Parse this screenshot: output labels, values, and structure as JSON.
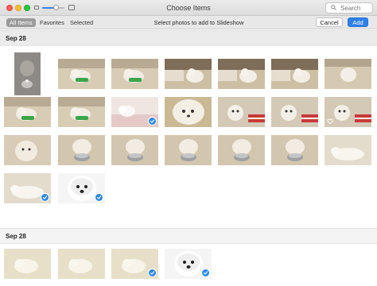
{
  "window": {
    "title": "Choose Items",
    "search_placeholder": "Search",
    "icons": [
      "close-button",
      "minimize-button",
      "zoom-button",
      "zoom-small-icon",
      "zoom-large-icon",
      "search-icon"
    ],
    "zoom_slider_fraction": 0.6
  },
  "toolbar": {
    "tabs": [
      {
        "label": "All Items",
        "active": true
      },
      {
        "label": "Favorites",
        "active": false
      },
      {
        "label": "Selected",
        "active": false
      }
    ],
    "instruction": "Select photos to add to Slideshow",
    "cancel_label": "Cancel",
    "add_label": "Add",
    "accent": "#2f80ed"
  },
  "sections": [
    {
      "date": "Sep 28",
      "photos": [
        {
          "scene": "portrait-dark",
          "selected": false,
          "favorite": false
        },
        {
          "scene": "floor-toy",
          "selected": false,
          "favorite": false
        },
        {
          "scene": "floor-toy",
          "selected": false,
          "favorite": false
        },
        {
          "scene": "crate-dog",
          "selected": false,
          "favorite": false
        },
        {
          "scene": "crate-dog",
          "selected": false,
          "favorite": false
        },
        {
          "scene": "crate-dog",
          "selected": false,
          "favorite": false
        },
        {
          "scene": "floor-dog",
          "selected": false,
          "favorite": false
        },
        {
          "scene": "floor-toy",
          "selected": false,
          "favorite": false
        },
        {
          "scene": "floor-toy",
          "selected": false,
          "favorite": false
        },
        {
          "scene": "bed-dog",
          "selected": true,
          "favorite": false
        },
        {
          "scene": "closeup",
          "selected": false,
          "favorite": false
        },
        {
          "scene": "dog-stripe",
          "selected": false,
          "favorite": false
        },
        {
          "scene": "dog-stripe",
          "selected": false,
          "favorite": false
        },
        {
          "scene": "dog-stripe",
          "selected": false,
          "favorite": true
        },
        {
          "scene": "fluffy",
          "selected": false,
          "favorite": false
        },
        {
          "scene": "bowl-dog",
          "selected": false,
          "favorite": false
        },
        {
          "scene": "bowl-dog",
          "selected": false,
          "favorite": false
        },
        {
          "scene": "bowl-dog",
          "selected": false,
          "favorite": false
        },
        {
          "scene": "bowl-dog",
          "selected": false,
          "favorite": false
        },
        {
          "scene": "bowl-dog",
          "selected": false,
          "favorite": false
        },
        {
          "scene": "lying-dog",
          "selected": false,
          "favorite": false
        },
        {
          "scene": "lying-dog",
          "selected": true,
          "favorite": false
        },
        {
          "scene": "white-face",
          "selected": true,
          "favorite": false
        }
      ]
    },
    {
      "date": "Sep 28",
      "photos": [
        {
          "scene": "light-dog",
          "selected": false,
          "favorite": false
        },
        {
          "scene": "light-dog",
          "selected": false,
          "favorite": false
        },
        {
          "scene": "light-dog",
          "selected": true,
          "favorite": false
        },
        {
          "scene": "white-face",
          "selected": true,
          "favorite": false
        }
      ]
    }
  ]
}
